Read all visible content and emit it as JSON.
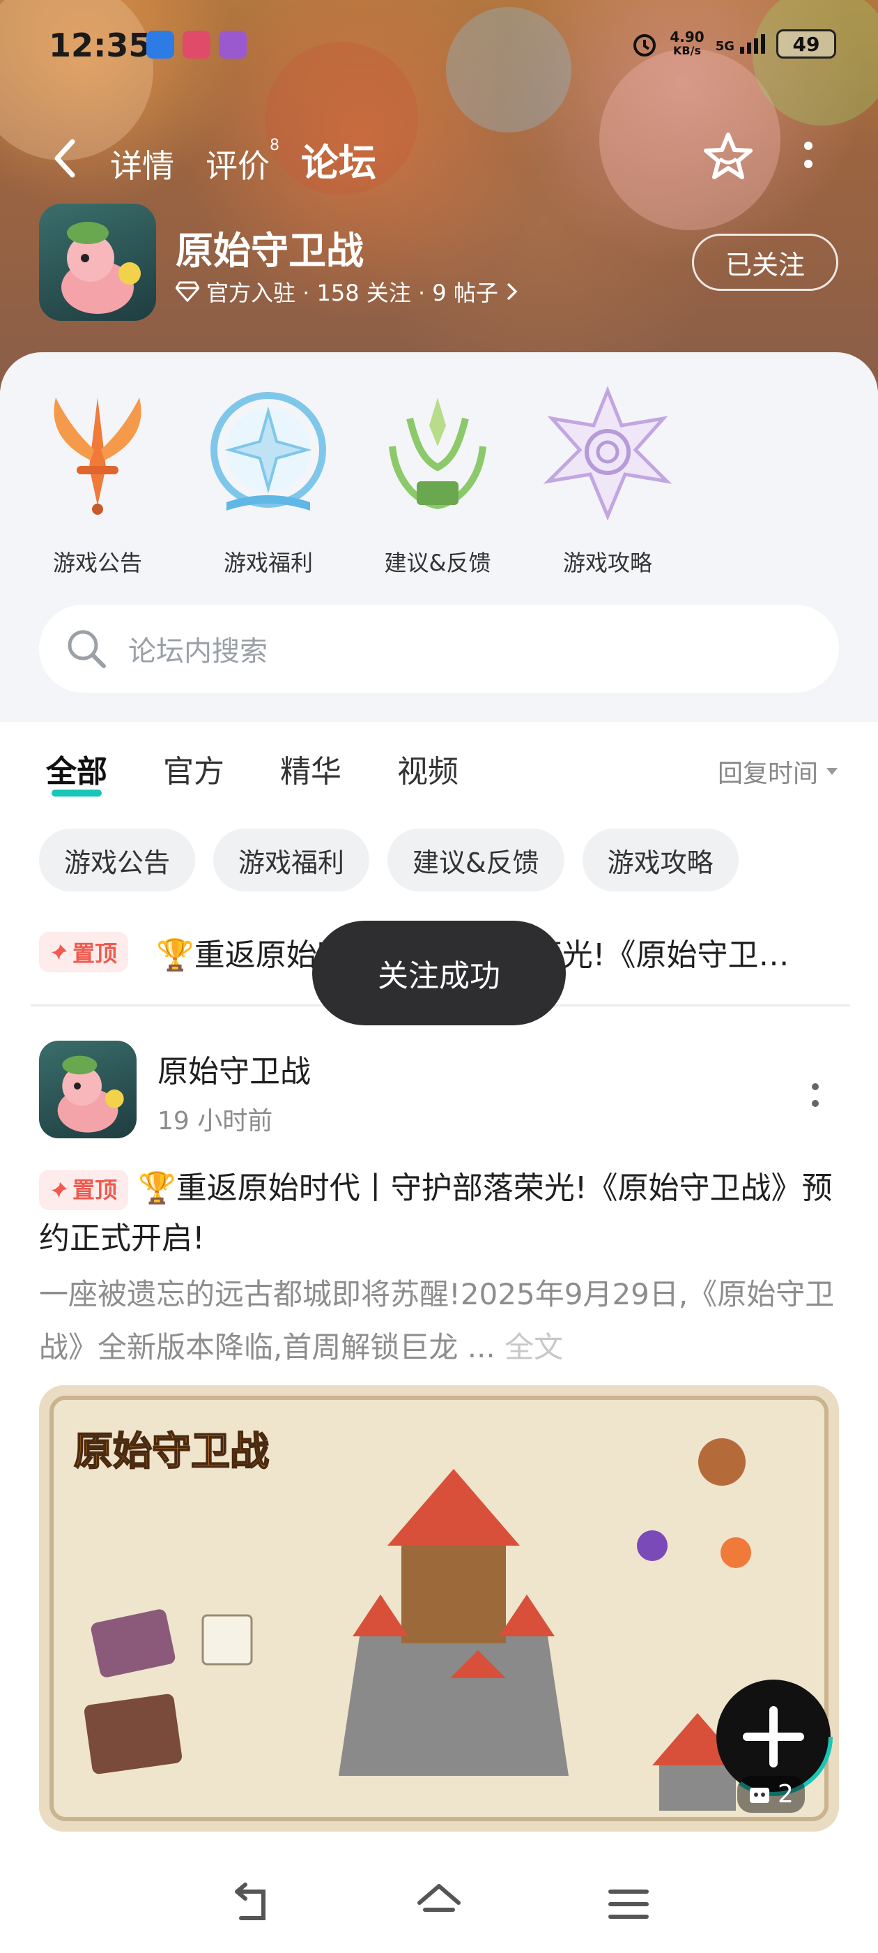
{
  "status_bar": {
    "time": "12:35",
    "network_speed": "4.90",
    "network_unit": "KB/s",
    "network_type": "5G",
    "battery": "49"
  },
  "nav": {
    "tabs": [
      {
        "label": "详情"
      },
      {
        "label": "评价",
        "badge": "8"
      },
      {
        "label": "论坛"
      }
    ],
    "active_tab": "论坛"
  },
  "app": {
    "name": "原始守卫战",
    "meta": "官方入驻 · 158 关注 · 9 帖子",
    "follow_label": "已关注"
  },
  "categories": [
    {
      "label": "游戏公告",
      "icon": "sword-wings-emblem-icon",
      "color": "#f07a3a"
    },
    {
      "label": "游戏福利",
      "icon": "compass-star-emblem-icon",
      "color": "#5fb7e5"
    },
    {
      "label": "建议&反馈",
      "icon": "leaf-crown-emblem-icon",
      "color": "#8cc96a"
    },
    {
      "label": "游戏攻略",
      "icon": "spiral-star-emblem-icon",
      "color": "#b79ad8"
    }
  ],
  "search": {
    "placeholder": "论坛内搜索"
  },
  "filter_tabs": [
    {
      "label": "全部"
    },
    {
      "label": "官方"
    },
    {
      "label": "精华"
    },
    {
      "label": "视频"
    }
  ],
  "sort_label": "回复时间",
  "chips": [
    {
      "label": "游戏公告"
    },
    {
      "label": "游戏福利"
    },
    {
      "label": "建议&反馈"
    },
    {
      "label": "游戏攻略"
    }
  ],
  "pinned": {
    "badge": "置顶",
    "title": "🏆重返原始时代丨守护部落荣光!《原始守卫战》预约正式开启!"
  },
  "toast": "关注成功",
  "post": {
    "author": "原始守卫战",
    "time": "19 小时前",
    "badge": "置顶",
    "title": "🏆重返原始时代丨守护部落荣光!《原始守卫战》预约正式开启!",
    "summary": "一座被遗忘的远古都城即将苏醒!2025年9月29日,《原始守卫战》全新版本降临,首周解锁巨龙 ...",
    "full_text_link": "全文",
    "image_logo": "原始守卫战",
    "image_count": "2"
  },
  "colors": {
    "accent": "#19c6b6",
    "pin_red": "#f05a4f",
    "toast_bg": "#2e2e30"
  }
}
